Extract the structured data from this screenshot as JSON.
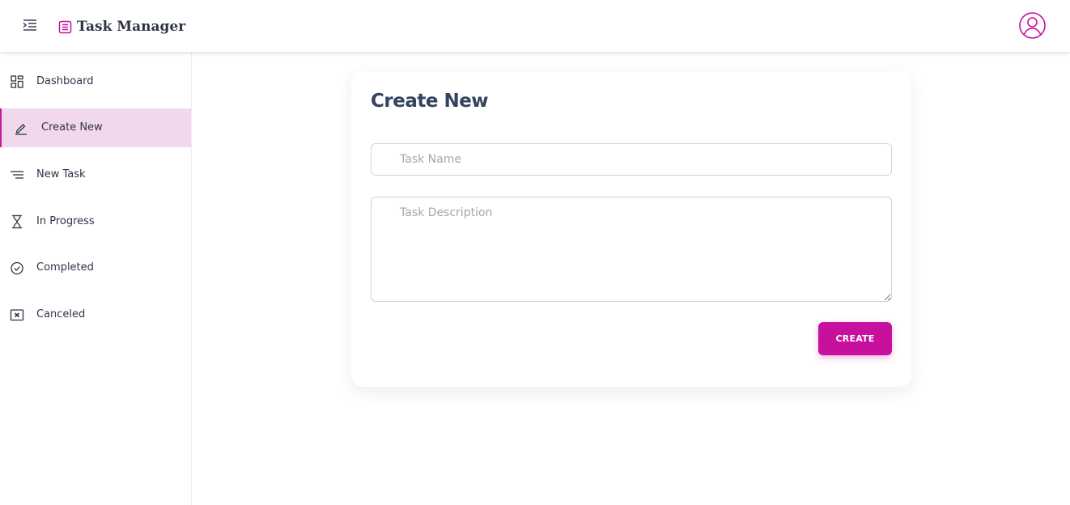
{
  "header": {
    "app_title": "Task Manager",
    "menu_icon": "menu-indent-icon",
    "brand_icon": "list-icon",
    "user_icon": "user-circle-icon"
  },
  "sidebar": {
    "items": [
      {
        "label": "Dashboard",
        "icon": "dashboard-icon",
        "active": false
      },
      {
        "label": "Create New",
        "icon": "pencil-icon",
        "active": true
      },
      {
        "label": "New Task",
        "icon": "lines-icon",
        "active": false
      },
      {
        "label": "In Progress",
        "icon": "hourglass-icon",
        "active": false
      },
      {
        "label": "Completed",
        "icon": "check-circle-icon",
        "active": false
      },
      {
        "label": "Canceled",
        "icon": "x-square-icon",
        "active": false
      }
    ]
  },
  "form": {
    "title": "Create New",
    "task_name_placeholder": "Task Name",
    "task_name_value": "",
    "task_description_placeholder": "Task Description",
    "task_description_value": "",
    "create_label": "CREATE"
  },
  "colors": {
    "accent": "#c8109f",
    "active_bg": "#f2d8ec",
    "text": "#2d3448",
    "title": "#34435e"
  }
}
